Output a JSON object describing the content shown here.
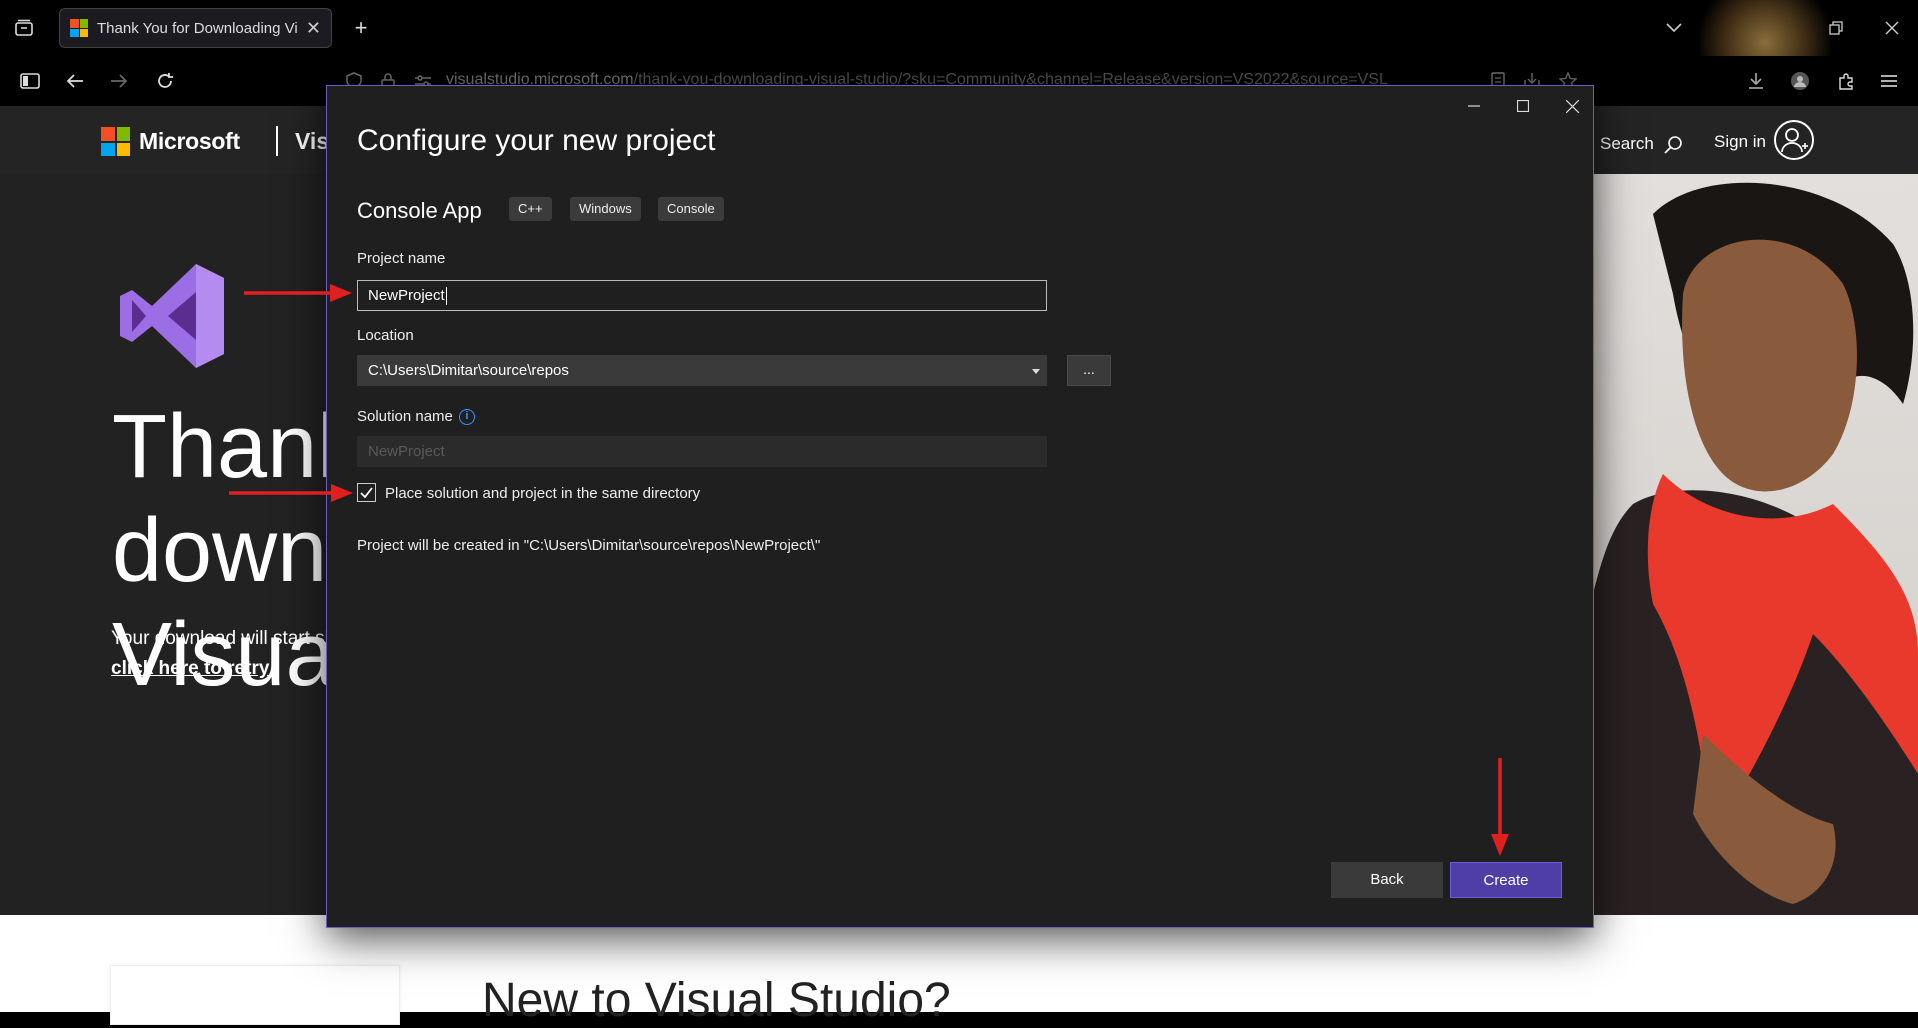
{
  "browser": {
    "tab_title": "Thank You for Downloading Vis",
    "tab_close": "✕",
    "new_tab": "+",
    "url_host": "visualstudio.microsoft.com",
    "url_path": "/thank-you-downloading-visual-studio/?sku=Community&channel=Release&version=VS2022&source=VSL"
  },
  "site": {
    "brand": "Microsoft",
    "product_partial": "Vis",
    "search_label": "Search",
    "signin_label": "Sign in",
    "headline_lines": [
      "Thank",
      "down",
      "Visual"
    ],
    "download_text": "Your download will start sh",
    "retry_link": "click here to retry",
    "below_heading": "New to Visual Studio?"
  },
  "dialog": {
    "title": "Configure your new project",
    "template_name": "Console App",
    "tags": [
      "C++",
      "Windows",
      "Console"
    ],
    "project_name_label": "Project name",
    "project_name_value": "NewProject",
    "location_label": "Location",
    "location_value": "C:\\Users\\Dimitar\\source\\repos",
    "browse_label": "...",
    "solution_name_label": "Solution name",
    "solution_name_placeholder": "NewProject",
    "same_dir_label": "Place solution and project in the same directory",
    "same_dir_checked": true,
    "created_path_text": "Project will be created in \"C:\\Users\\Dimitar\\source\\repos\\NewProject\\\"",
    "back_label": "Back",
    "create_label": "Create"
  },
  "colors": {
    "accent": "#4e3ea5",
    "dialog_border": "#6b5fbf",
    "annotation_arrow": "#e02020"
  }
}
